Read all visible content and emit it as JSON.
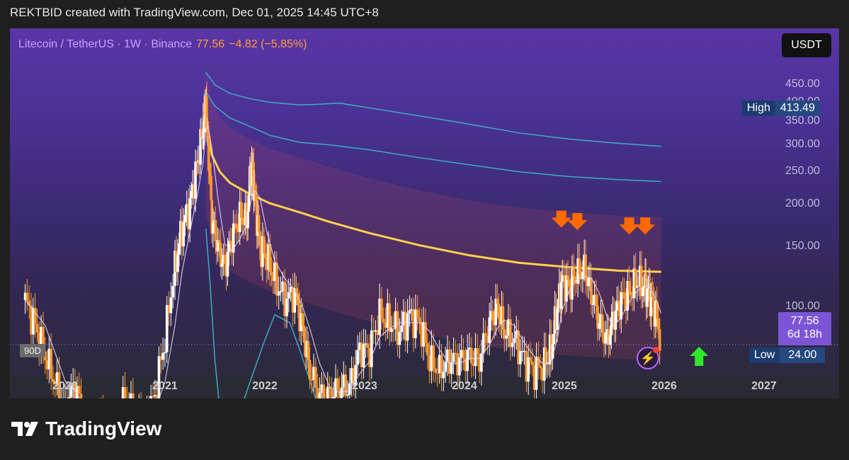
{
  "header": {
    "attribution": "REKTBID created with TradingView.com, Dec 01, 2025 14:45 UTC+8"
  },
  "legend": {
    "symbol": "Litecoin / TetherUS · 1W · Binance",
    "price": "77.56",
    "change": "−4.82 (−5.85%)"
  },
  "currency_button": "USDT",
  "price_tag": {
    "price": "77.56",
    "countdown": "6d 18h"
  },
  "high": {
    "label": "High",
    "value": "413.49"
  },
  "low": {
    "label": "Low",
    "value": "24.00"
  },
  "period_tag": "90D",
  "brand": "TradingView",
  "colors": {
    "accent": "#7c55d6",
    "candle_up": "#ffffff",
    "candle_down": "#ff9a2e",
    "vwap": "#ffd24a",
    "band": "#3fb9c9",
    "arrow_down": "#ff6a00",
    "arrow_up": "#2ee82e"
  },
  "chart_data": {
    "type": "candlestick",
    "title": "",
    "xlabel": "",
    "ylabel": "",
    "x_ticks": [
      "2020",
      "2021",
      "2022",
      "2023",
      "2024",
      "2025",
      "2026",
      "2027"
    ],
    "y_ticks": [
      "450.00",
      "400.00",
      "350.00",
      "300.00",
      "250.00",
      "200.00",
      "150.00",
      "100.00"
    ],
    "ylim": [
      35,
      490
    ],
    "xlim": [
      2019.55,
      2027.35
    ],
    "grid": false,
    "price_close_line": 77.56,
    "low_line": 24.0,
    "high_value": 413.49,
    "price_path": [
      [
        2019.55,
        105
      ],
      [
        2019.65,
        88
      ],
      [
        2019.75,
        72
      ],
      [
        2019.85,
        60
      ],
      [
        2019.95,
        50
      ],
      [
        2020.05,
        60
      ],
      [
        2020.15,
        42
      ],
      [
        2020.25,
        45
      ],
      [
        2020.35,
        47
      ],
      [
        2020.45,
        44
      ],
      [
        2020.55,
        55
      ],
      [
        2020.65,
        48
      ],
      [
        2020.75,
        46
      ],
      [
        2020.85,
        55
      ],
      [
        2020.95,
        80
      ],
      [
        2021.05,
        130
      ],
      [
        2021.12,
        170
      ],
      [
        2021.2,
        200
      ],
      [
        2021.27,
        260
      ],
      [
        2021.33,
        330
      ],
      [
        2021.36,
        400
      ],
      [
        2021.38,
        300
      ],
      [
        2021.42,
        180
      ],
      [
        2021.48,
        150
      ],
      [
        2021.55,
        130
      ],
      [
        2021.62,
        160
      ],
      [
        2021.7,
        185
      ],
      [
        2021.77,
        180
      ],
      [
        2021.82,
        270
      ],
      [
        2021.85,
        210
      ],
      [
        2021.9,
        150
      ],
      [
        2021.97,
        140
      ],
      [
        2022.05,
        120
      ],
      [
        2022.15,
        105
      ],
      [
        2022.25,
        110
      ],
      [
        2022.33,
        85
      ],
      [
        2022.4,
        65
      ],
      [
        2022.5,
        55
      ],
      [
        2022.6,
        55
      ],
      [
        2022.7,
        58
      ],
      [
        2022.8,
        58
      ],
      [
        2022.9,
        75
      ],
      [
        2023.0,
        75
      ],
      [
        2023.1,
        95
      ],
      [
        2023.2,
        90
      ],
      [
        2023.3,
        85
      ],
      [
        2023.4,
        95
      ],
      [
        2023.5,
        90
      ],
      [
        2023.6,
        70
      ],
      [
        2023.7,
        65
      ],
      [
        2023.8,
        70
      ],
      [
        2023.9,
        70
      ],
      [
        2024.0,
        72
      ],
      [
        2024.1,
        70
      ],
      [
        2024.2,
        90
      ],
      [
        2024.28,
        100
      ],
      [
        2024.35,
        85
      ],
      [
        2024.45,
        80
      ],
      [
        2024.55,
        70
      ],
      [
        2024.65,
        65
      ],
      [
        2024.75,
        68
      ],
      [
        2024.82,
        75
      ],
      [
        2024.88,
        100
      ],
      [
        2024.93,
        120
      ],
      [
        2025.0,
        115
      ],
      [
        2025.07,
        125
      ],
      [
        2025.15,
        130
      ],
      [
        2025.22,
        110
      ],
      [
        2025.3,
        90
      ],
      [
        2025.38,
        80
      ],
      [
        2025.45,
        95
      ],
      [
        2025.52,
        105
      ],
      [
        2025.6,
        110
      ],
      [
        2025.68,
        120
      ],
      [
        2025.75,
        115
      ],
      [
        2025.8,
        110
      ],
      [
        2025.85,
        100
      ],
      [
        2025.92,
        78
      ]
    ],
    "series": [
      {
        "values": [
          [
            2021.36,
            345
          ],
          [
            2021.42,
            280
          ],
          [
            2021.5,
            250
          ],
          [
            2021.6,
            232
          ],
          [
            2021.8,
            215
          ],
          [
            2022.0,
            202
          ],
          [
            2022.3,
            190
          ],
          [
            2022.6,
            178
          ],
          [
            2023.0,
            165
          ],
          [
            2023.5,
            152
          ],
          [
            2024.0,
            142
          ],
          [
            2024.5,
            135
          ],
          [
            2025.0,
            131
          ],
          [
            2025.5,
            128
          ],
          [
            2025.92,
            127
          ]
        ]
      },
      {
        "values": [
          [
            2021.36,
            490
          ],
          [
            2021.45,
            450
          ],
          [
            2021.6,
            425
          ],
          [
            2021.8,
            410
          ],
          [
            2022.0,
            400
          ],
          [
            2022.3,
            393
          ],
          [
            2022.5,
            395
          ],
          [
            2022.7,
            398
          ],
          [
            2023.0,
            385
          ],
          [
            2023.5,
            365
          ],
          [
            2024.0,
            345
          ],
          [
            2024.5,
            325
          ],
          [
            2025.0,
            312
          ],
          [
            2025.5,
            303
          ],
          [
            2025.92,
            297
          ]
        ]
      },
      {
        "values": [
          [
            2021.36,
            430
          ],
          [
            2021.45,
            390
          ],
          [
            2021.6,
            360
          ],
          [
            2021.8,
            340
          ],
          [
            2022.0,
            320
          ],
          [
            2022.3,
            305
          ],
          [
            2022.6,
            300
          ],
          [
            2023.0,
            290
          ],
          [
            2023.5,
            275
          ],
          [
            2024.0,
            262
          ],
          [
            2024.5,
            250
          ],
          [
            2025.0,
            242
          ],
          [
            2025.5,
            237
          ],
          [
            2025.92,
            234
          ]
        ]
      },
      {
        "values": [
          [
            2021.36,
            170
          ],
          [
            2021.4,
            120
          ],
          [
            2021.45,
            70
          ],
          [
            2021.5,
            50
          ],
          [
            2021.6,
            40
          ],
          [
            2021.8,
            60
          ],
          [
            2021.95,
            80
          ],
          [
            2022.05,
            95
          ],
          [
            2022.2,
            90
          ],
          [
            2022.3,
            75
          ],
          [
            2022.45,
            55
          ],
          [
            2022.6,
            40
          ],
          [
            2022.7,
            35
          ]
        ]
      }
    ],
    "annotations": [
      {
        "type": "arrow-down",
        "x": 2024.92,
        "y": 178
      },
      {
        "type": "arrow-down",
        "x": 2025.08,
        "y": 175
      },
      {
        "type": "arrow-down",
        "x": 2025.6,
        "y": 170
      },
      {
        "type": "arrow-down",
        "x": 2025.76,
        "y": 170
      },
      {
        "type": "arrow-up",
        "x": 2026.3,
        "y": 40
      }
    ]
  }
}
